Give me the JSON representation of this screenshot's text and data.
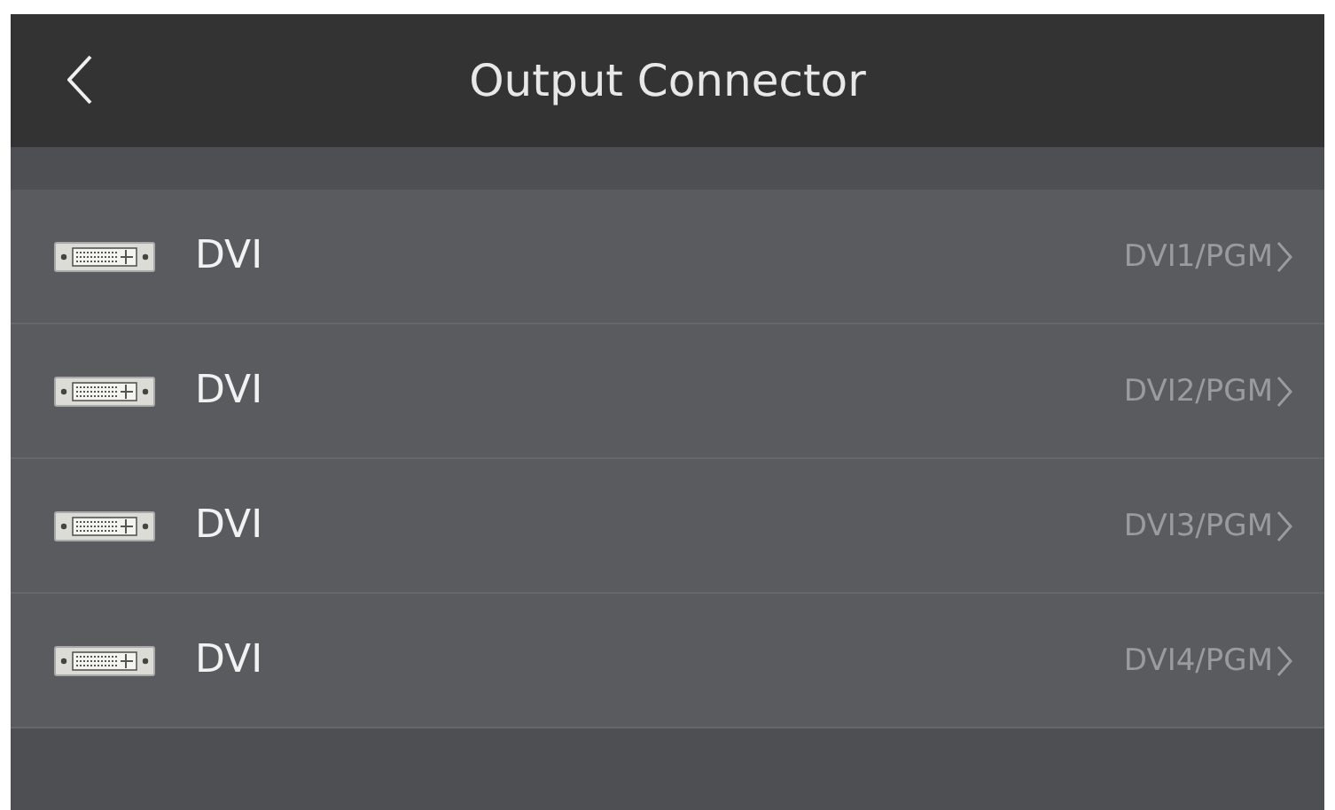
{
  "header": {
    "title": "Output Connector"
  },
  "connectors": [
    {
      "name": "DVI",
      "output": "DVI1/PGM"
    },
    {
      "name": "DVI",
      "output": "DVI2/PGM"
    },
    {
      "name": "DVI",
      "output": "DVI3/PGM"
    },
    {
      "name": "DVI",
      "output": "DVI4/PGM"
    }
  ]
}
